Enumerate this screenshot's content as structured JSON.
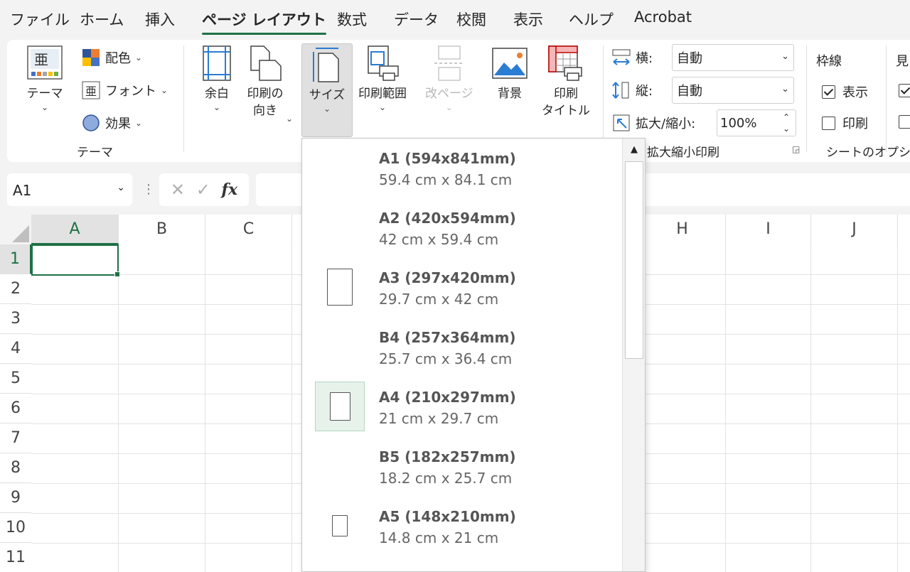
{
  "tabs": [
    "ファイル",
    "ホーム",
    "挿入",
    "ページ レイアウト",
    "数式",
    "データ",
    "校閲",
    "表示",
    "ヘルプ",
    "Acrobat"
  ],
  "ribbon": {
    "theme_group": {
      "theme_label": "テーマ",
      "colors_label": "配色",
      "fonts_label": "フォント",
      "effects_label": "効果",
      "group_label": "テーマ",
      "theme_icon_text": "亜"
    },
    "page_setup": {
      "margins_label": "余白",
      "orientation_label": "印刷の\n向き",
      "size_label": "サイズ",
      "print_area_label": "印刷範囲",
      "breaks_label": "改ページ",
      "background_label": "背景",
      "print_titles_label": "印刷\nタイトル"
    },
    "scale": {
      "width_label": "横:",
      "width_value": "自動",
      "height_label": "縦:",
      "height_value": "自動",
      "scale_label": "拡大/縮小:",
      "scale_value": "100%",
      "group_label": "拡大縮小印刷"
    },
    "sheet_options": {
      "gridlines_label": "枠線",
      "headings_label": "見",
      "view_label": "表示",
      "view_checked": true,
      "print_label": "印刷",
      "print_checked": false,
      "group_label": "シートのオプシ"
    }
  },
  "formula_bar": {
    "name_box": "A1",
    "fx_label": "fx",
    "content": ""
  },
  "sheet": {
    "columns": [
      "A",
      "B",
      "C",
      "",
      "",
      "",
      "",
      "H",
      "I",
      "J"
    ],
    "rows": [
      "1",
      "2",
      "3",
      "4",
      "5",
      "6",
      "7",
      "8",
      "9",
      "10",
      "11"
    ],
    "active_cell": "A1"
  },
  "size_dropdown": {
    "items": [
      {
        "name": "A1 (594x841mm)",
        "dims": "59.4 cm x 84.1 cm",
        "selected": false
      },
      {
        "name": "A2 (420x594mm)",
        "dims": "42 cm x 59.4 cm",
        "selected": false
      },
      {
        "name": "A3 (297x420mm)",
        "dims": "29.7 cm x 42 cm",
        "selected": false
      },
      {
        "name": "B4 (257x364mm)",
        "dims": "25.7 cm x 36.4 cm",
        "selected": false
      },
      {
        "name": "A4 (210x297mm)",
        "dims": "21 cm x 29.7 cm",
        "selected": true
      },
      {
        "name": "B5 (182x257mm)",
        "dims": "18.2 cm x 25.7 cm",
        "selected": false
      },
      {
        "name": "A5 (148x210mm)",
        "dims": "14.8 cm x 21 cm",
        "selected": false
      }
    ]
  },
  "colors": {
    "accent": "#1e7145",
    "selected_bg": "#e6f2ea"
  }
}
